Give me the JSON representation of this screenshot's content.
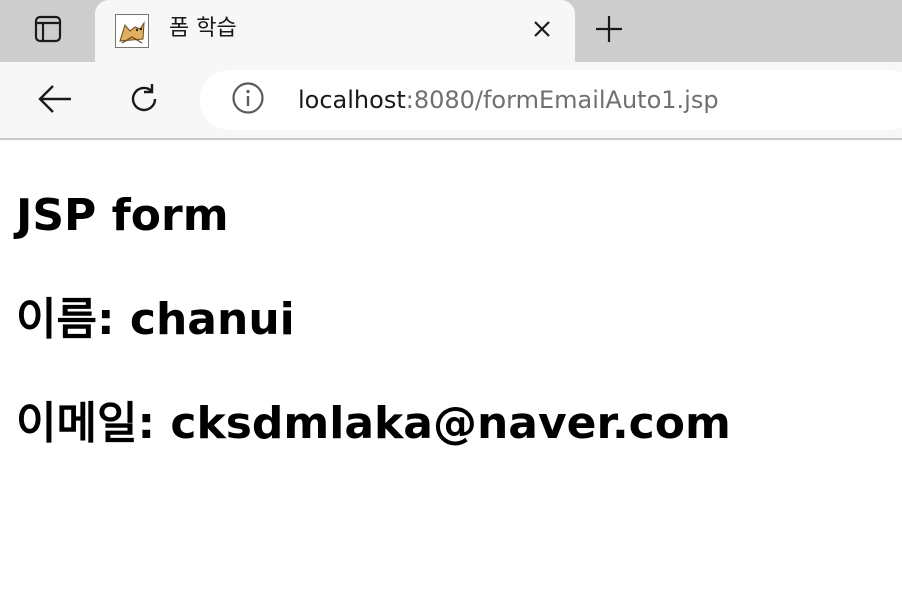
{
  "tab": {
    "title": "폼 학습",
    "favicon": "tomcat-favicon-icon"
  },
  "address_bar": {
    "host": "localhost",
    "rest": ":8080/formEmailAuto1.jsp"
  },
  "page": {
    "heading": "JSP form",
    "name_label": "이름:",
    "name_value": "chanui",
    "email_label": "이메일:",
    "email_value": "cksdmlaka@naver.com"
  },
  "colors": {
    "tabstrip_bg": "#cdcdcd",
    "toolbar_bg": "#f7f7f7",
    "url_secondary": "#707070"
  }
}
